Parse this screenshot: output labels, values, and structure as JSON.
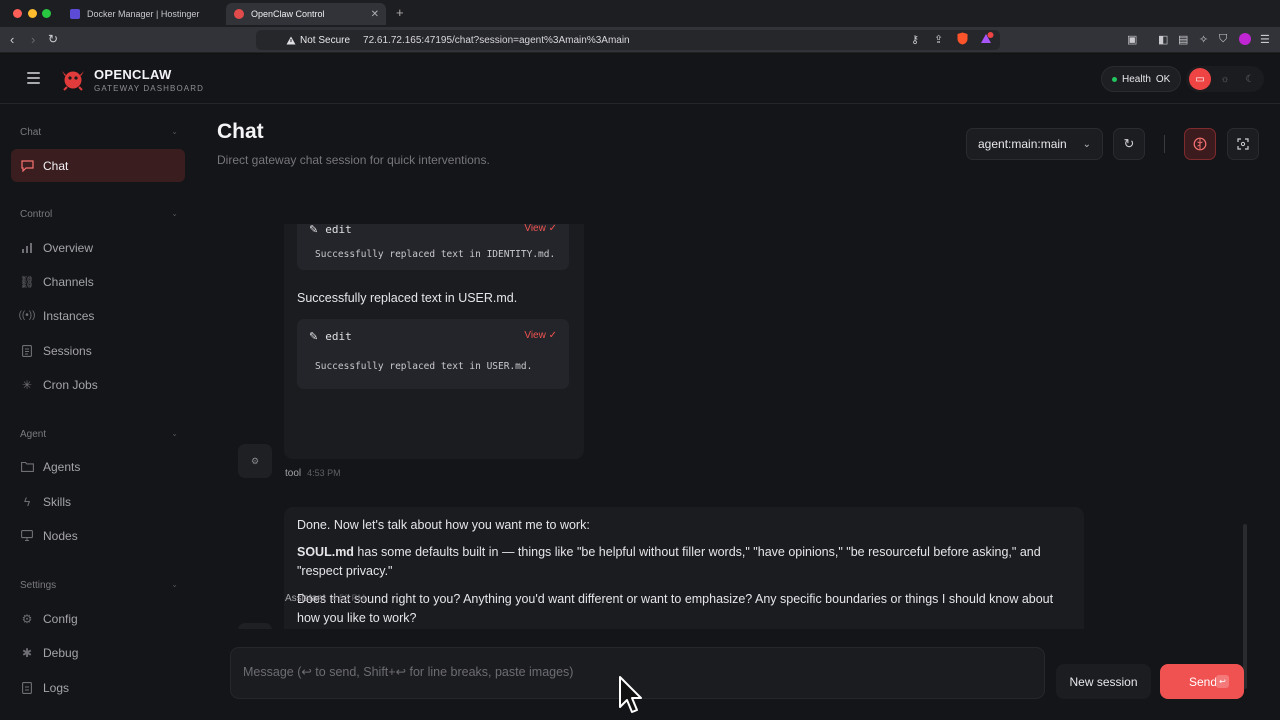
{
  "browser": {
    "tabs": [
      {
        "label": "Docker Manager | Hostinger",
        "active": false
      },
      {
        "label": "OpenClaw Control",
        "active": true
      }
    ],
    "security_label": "Not Secure",
    "url": "72.61.72.165:47195/chat?session=agent%3Amain%3Amain",
    "extension_badge": "1"
  },
  "app": {
    "brand_name": "OPENCLAW",
    "brand_tagline": "GATEWAY DASHBOARD",
    "health_label": "Health",
    "health_status": "OK",
    "health_color": "#22c55e",
    "accent_color": "#ef4444"
  },
  "sidebar": {
    "sections": [
      {
        "label": "Chat",
        "items": [
          {
            "label": "Chat",
            "icon": "message-square-icon",
            "active": true
          }
        ]
      },
      {
        "label": "Control",
        "items": [
          {
            "label": "Overview",
            "icon": "bar-chart-icon"
          },
          {
            "label": "Channels",
            "icon": "link-icon"
          },
          {
            "label": "Instances",
            "icon": "radio-icon"
          },
          {
            "label": "Sessions",
            "icon": "file-text-icon"
          },
          {
            "label": "Cron Jobs",
            "icon": "loader-icon"
          }
        ]
      },
      {
        "label": "Agent",
        "items": [
          {
            "label": "Agents",
            "icon": "folder-icon"
          },
          {
            "label": "Skills",
            "icon": "zap-icon"
          },
          {
            "label": "Nodes",
            "icon": "monitor-icon"
          }
        ]
      },
      {
        "label": "Settings",
        "items": [
          {
            "label": "Config",
            "icon": "gear-icon"
          },
          {
            "label": "Debug",
            "icon": "bug-icon"
          },
          {
            "label": "Logs",
            "icon": "log-file-icon"
          }
        ]
      }
    ]
  },
  "page": {
    "title": "Chat",
    "subtitle": "Direct gateway chat session for quick interventions.",
    "session_selected": "agent:main:main"
  },
  "thread": {
    "tool_message": {
      "cards": [
        {
          "tool": "edit",
          "view_label": "View ✓",
          "output": "Successfully replaced text in IDENTITY.md."
        },
        {
          "tool": "edit",
          "view_label": "View ✓",
          "output": "Successfully replaced text in USER.md."
        }
      ],
      "text_between": "Successfully replaced text in USER.md.",
      "sender": "tool",
      "time": "4:53 PM"
    },
    "assistant_message": {
      "avatar_letter": "A",
      "para1": "Done. Now let's talk about how you want me to work:",
      "para2_bold": "SOUL.md",
      "para2_rest": " has some defaults built in — things like \"be helpful without filler words,\" \"have opinions,\" \"be resourceful before asking,\" and \"respect privacy.\"",
      "para3": "Does that sound right to you? Anything you'd want different or want to emphasize? Any specific boundaries or things I should know about how you like to work?",
      "sender": "Assistant",
      "time": "4:53 PM"
    }
  },
  "composer": {
    "placeholder": "Message (↩ to send, Shift+↩ for line breaks, paste images)",
    "value": "",
    "new_session_label": "New session",
    "send_label": "Send",
    "send_kbd": "↩"
  }
}
